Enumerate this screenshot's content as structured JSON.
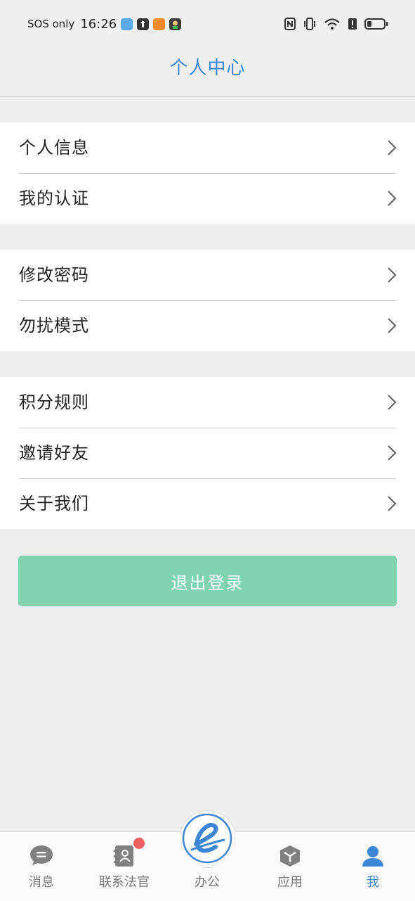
{
  "status_bar": {
    "carrier": "SOS only",
    "time": "16:26",
    "icons": [
      "photos-icon",
      "upload-icon",
      "news-icon",
      "game-icon",
      "nfc-icon",
      "vibrate-icon",
      "wifi-icon",
      "alert-icon",
      "battery-icon"
    ]
  },
  "header": {
    "title": "个人中心"
  },
  "groups": [
    {
      "items": [
        {
          "label": "个人信息"
        },
        {
          "label": "我的认证"
        }
      ]
    },
    {
      "items": [
        {
          "label": "修改密码"
        },
        {
          "label": "勿扰模式"
        }
      ]
    },
    {
      "items": [
        {
          "label": "积分规则"
        },
        {
          "label": "邀请好友"
        },
        {
          "label": "关于我们"
        }
      ]
    }
  ],
  "logout": {
    "label": "退出登录",
    "color": "#80d2b0"
  },
  "tabbar": {
    "items": [
      {
        "label": "消息",
        "icon": "message-icon"
      },
      {
        "label": "联系法官",
        "icon": "contact-book-icon",
        "badge": true
      },
      {
        "label": "办公",
        "icon": "office-e-icon"
      },
      {
        "label": "应用",
        "icon": "cube-icon"
      },
      {
        "label": "我",
        "icon": "person-icon",
        "active": true
      }
    ],
    "active_color": "#3d86d6"
  },
  "colors": {
    "accent": "#3d86d6",
    "background": "#efefef",
    "badge": "#f06060"
  }
}
